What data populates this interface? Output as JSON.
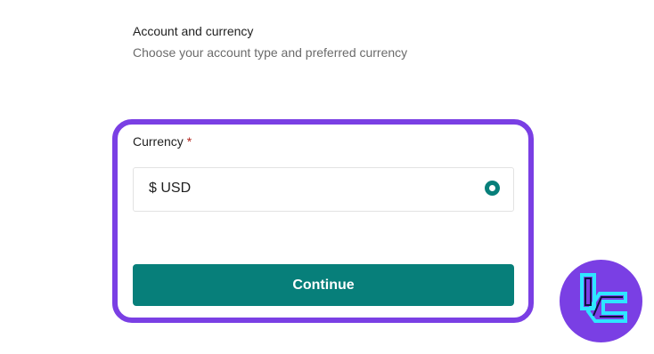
{
  "header": {
    "title": "Account and currency",
    "subtitle": "Choose your account type and preferred currency"
  },
  "currency_field": {
    "label": "Currency",
    "required_marker": "*",
    "selected_option": "$ USD",
    "selected": true
  },
  "actions": {
    "continue_label": "Continue"
  },
  "colors": {
    "accent": "#077f7a",
    "highlight_frame": "#7a3fe4",
    "required": "#b3261e",
    "badge_background": "#7a3fe4",
    "badge_logo": "#2ee6ff"
  },
  "icons": {
    "radio": "radio-selected-icon",
    "badge": "brand-logo-icon"
  }
}
